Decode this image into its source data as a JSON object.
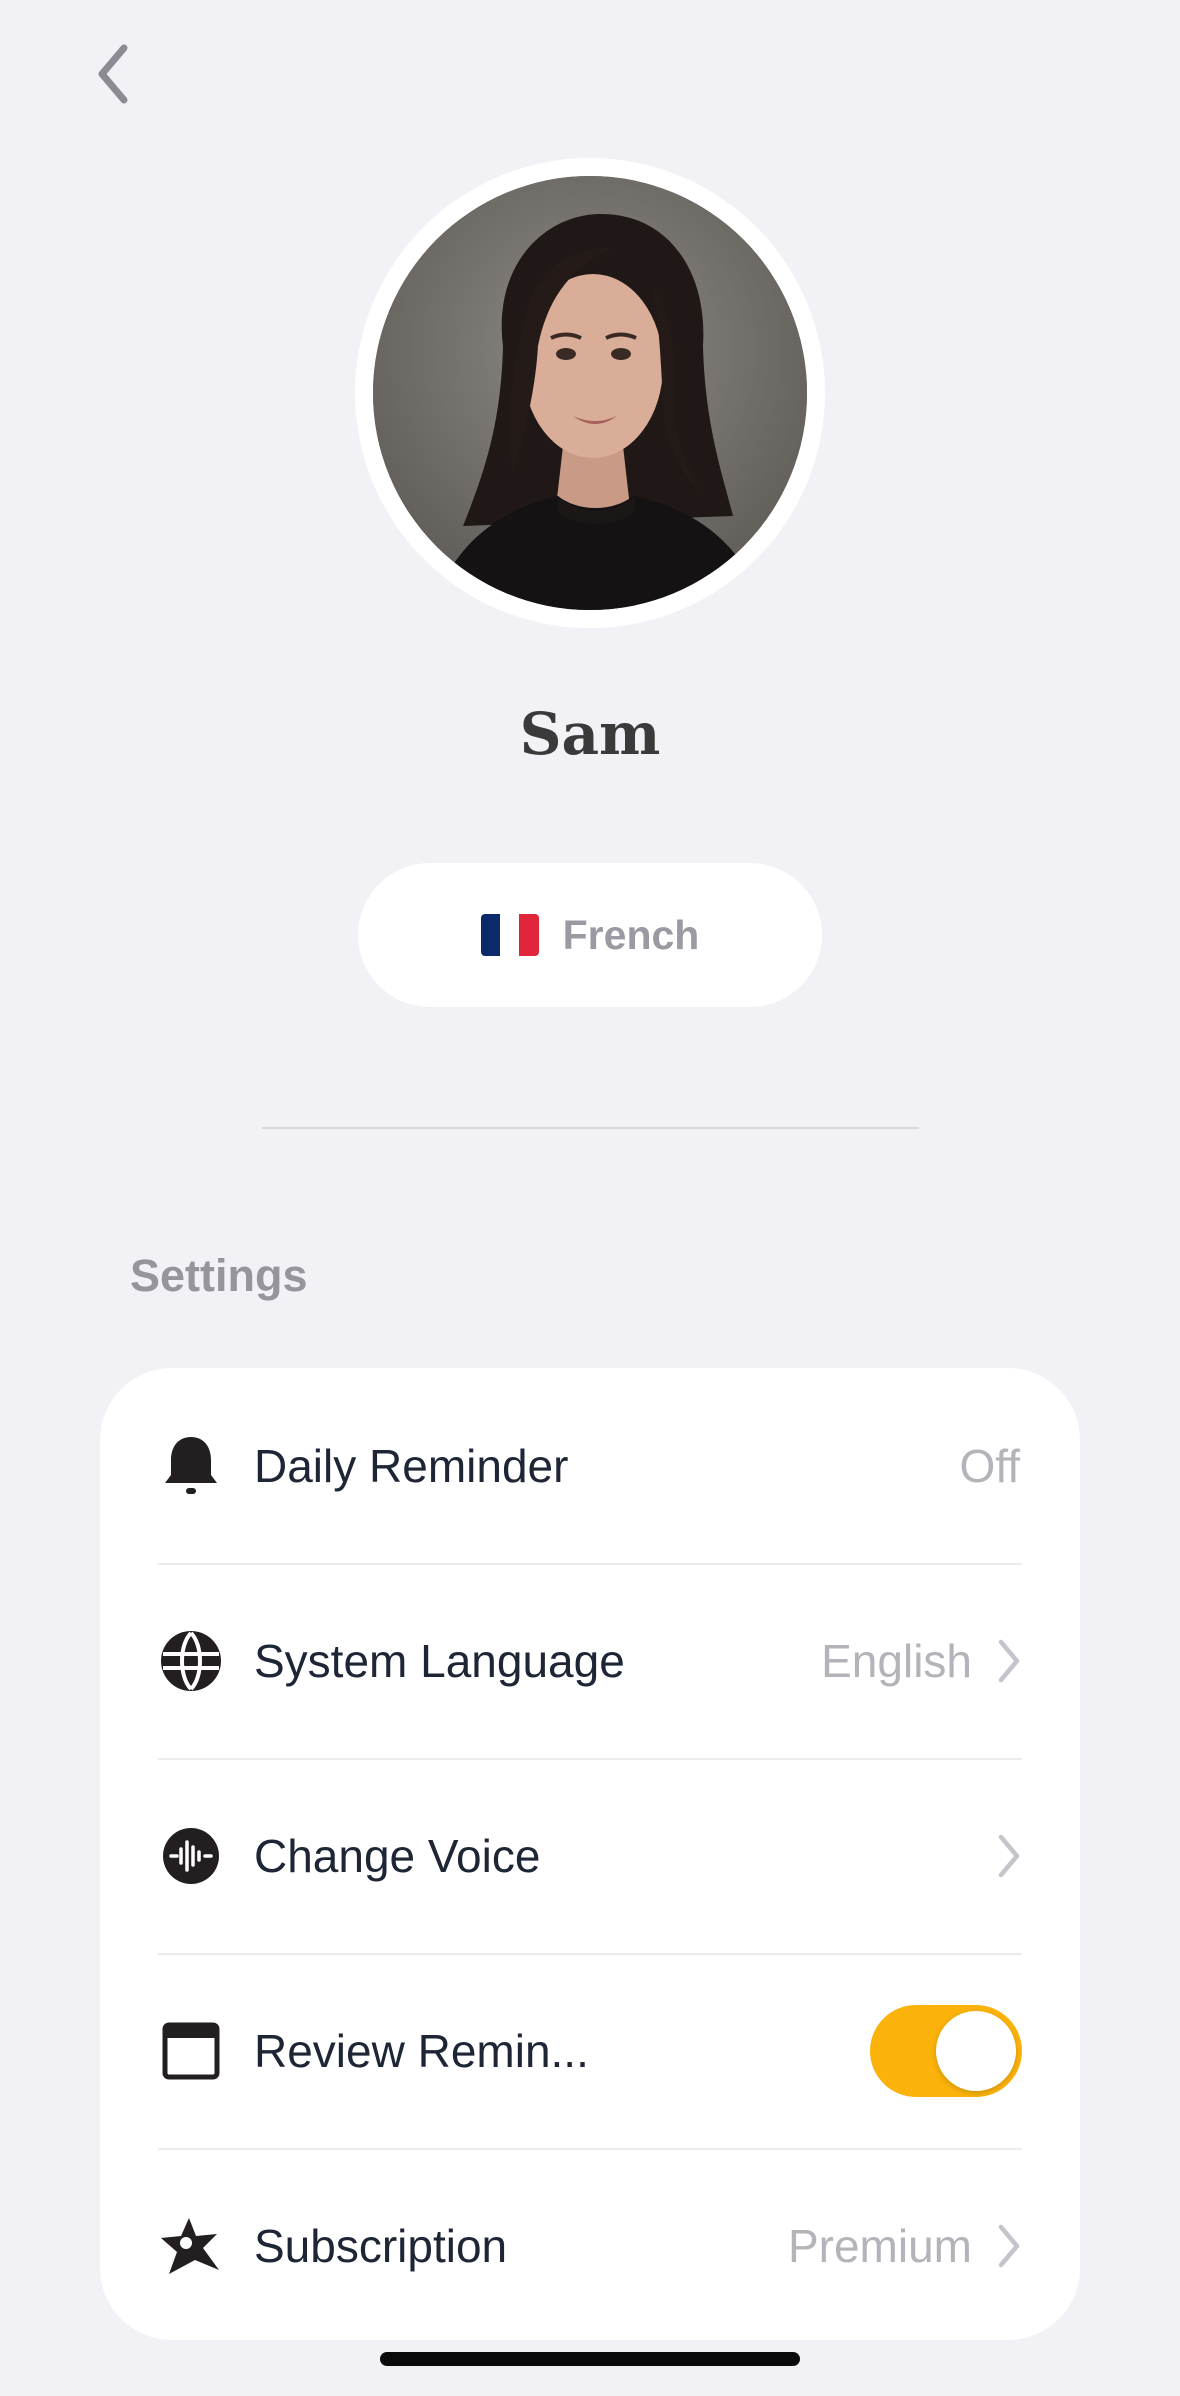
{
  "profile": {
    "name": "Sam",
    "language_label": "French",
    "flag_colors": [
      "#0b2a6b",
      "#ffffff",
      "#e1253a"
    ]
  },
  "settings": {
    "title": "Settings",
    "items": [
      {
        "label": "Daily Reminder",
        "value": "Off",
        "icon": "bell-icon"
      },
      {
        "label": "System Language",
        "value": "English",
        "icon": "globe-icon"
      },
      {
        "label": "Change Voice",
        "value": "",
        "icon": "voice-waveform-icon"
      },
      {
        "label": "Review Remin...",
        "toggle_on": true,
        "icon": "calendar-window-icon"
      },
      {
        "label": "Subscription",
        "value": "Premium",
        "icon": "star-badge-icon"
      }
    ]
  },
  "colors": {
    "background": "#f2f1f5",
    "accent_toggle": "#fbb20a",
    "label_text": "#1e2636",
    "muted_text": "#b3b3ba"
  }
}
